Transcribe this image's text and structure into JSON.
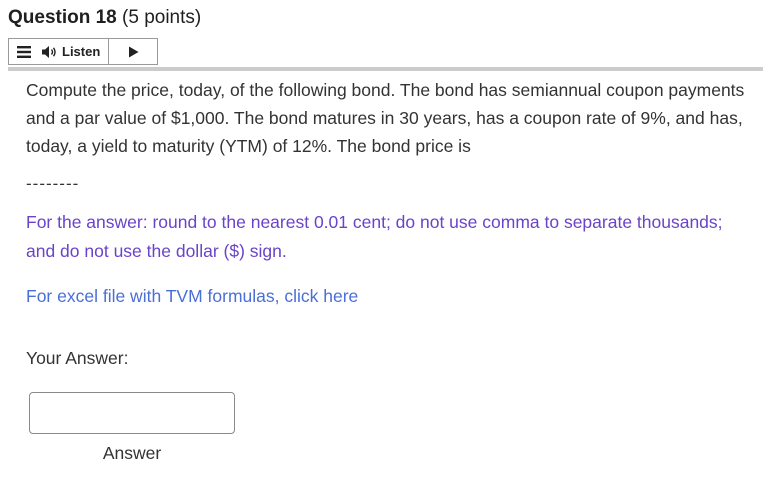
{
  "question": {
    "title": "Question 18",
    "points": "(5 points)"
  },
  "listen_bar": {
    "label": "Listen",
    "menu_icon": "menu-icon",
    "speaker_icon": "speaker-icon",
    "play_icon": "play-icon"
  },
  "body": {
    "problem_text": "Compute the price, today, of the following bond.  The bond has semiannual coupon payments and a par value of $1,000. The bond matures in 30 years, has a coupon rate of 9%, and has, today, a yield to maturity (YTM) of 12%. The bond price is",
    "blank": "--------",
    "instruction": "For the answer: round to the nearest 0.01 cent; do not use comma to separate thousands; and do not use the dollar ($) sign.",
    "excel_link": "For excel file with TVM formulas, click here"
  },
  "answer": {
    "prompt": "Your Answer:",
    "value": "",
    "caption": "Answer"
  },
  "colors": {
    "instruction": "#6a43c9",
    "link": "#4a6fd6",
    "text": "#333333"
  }
}
